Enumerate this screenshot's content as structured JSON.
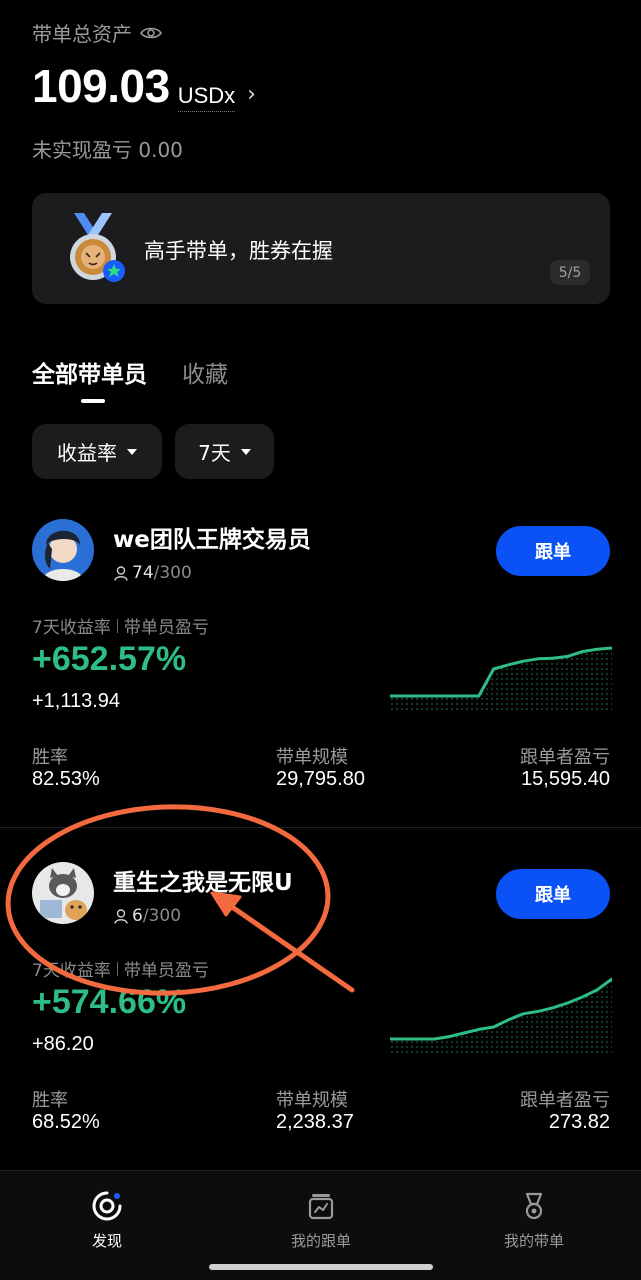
{
  "header": {
    "total_assets_label": "带单总资产",
    "total_assets_value": "109.03",
    "total_assets_unit": "USDx",
    "unrealized_pnl_label": "未实现盈亏",
    "unrealized_pnl_value": "0.00"
  },
  "banner": {
    "text": "高手带单，胜券在握",
    "page": "5/5"
  },
  "tabs": [
    {
      "label": "全部带单员",
      "active": true
    },
    {
      "label": "收藏",
      "active": false
    }
  ],
  "filters": {
    "sort": "收益率",
    "period": "7天"
  },
  "traders": [
    {
      "name": "we团队王牌交易员",
      "followers": "74",
      "followers_max": "/300",
      "follow_label": "跟单",
      "roi_label": "7天收益率",
      "pnl_label": "带单员盈亏",
      "roi": "+652.57%",
      "pnl": "+1,113.94",
      "win_rate_label": "胜率",
      "win_rate": "82.53%",
      "aum_label": "带单规模",
      "aum": "29,795.80",
      "follower_pnl_label": "跟单者盈亏",
      "follower_pnl": "15,595.40",
      "trend": [
        0,
        0,
        0,
        0,
        0,
        0,
        0,
        0.45,
        0.52,
        0.58,
        0.62,
        0.63,
        0.66,
        0.74,
        0.78,
        0.8
      ]
    },
    {
      "name": "重生之我是无限U",
      "followers": "6",
      "followers_max": "/300",
      "follow_label": "跟单",
      "roi_label": "7天收益率",
      "pnl_label": "带单员盈亏",
      "roi": "+574.66%",
      "pnl": "+86.20",
      "win_rate_label": "胜率",
      "win_rate": "68.52%",
      "aum_label": "带单规模",
      "aum": "2,238.37",
      "follower_pnl_label": "跟单者盈亏",
      "follower_pnl": "273.82",
      "trend": [
        0,
        0,
        0,
        0,
        0.04,
        0.1,
        0.16,
        0.2,
        0.32,
        0.42,
        0.46,
        0.52,
        0.6,
        0.7,
        0.82,
        1.0
      ]
    }
  ],
  "bottom_nav": [
    {
      "label": "发现",
      "icon": "discover-icon",
      "active": true
    },
    {
      "label": "我的跟单",
      "icon": "copy-trade-icon",
      "active": false
    },
    {
      "label": "我的带单",
      "icon": "lead-trade-icon",
      "active": false
    }
  ],
  "colors": {
    "accent_green": "#2ebd85",
    "button_blue": "#0a52f5",
    "annotation_orange": "#f26a3d"
  }
}
